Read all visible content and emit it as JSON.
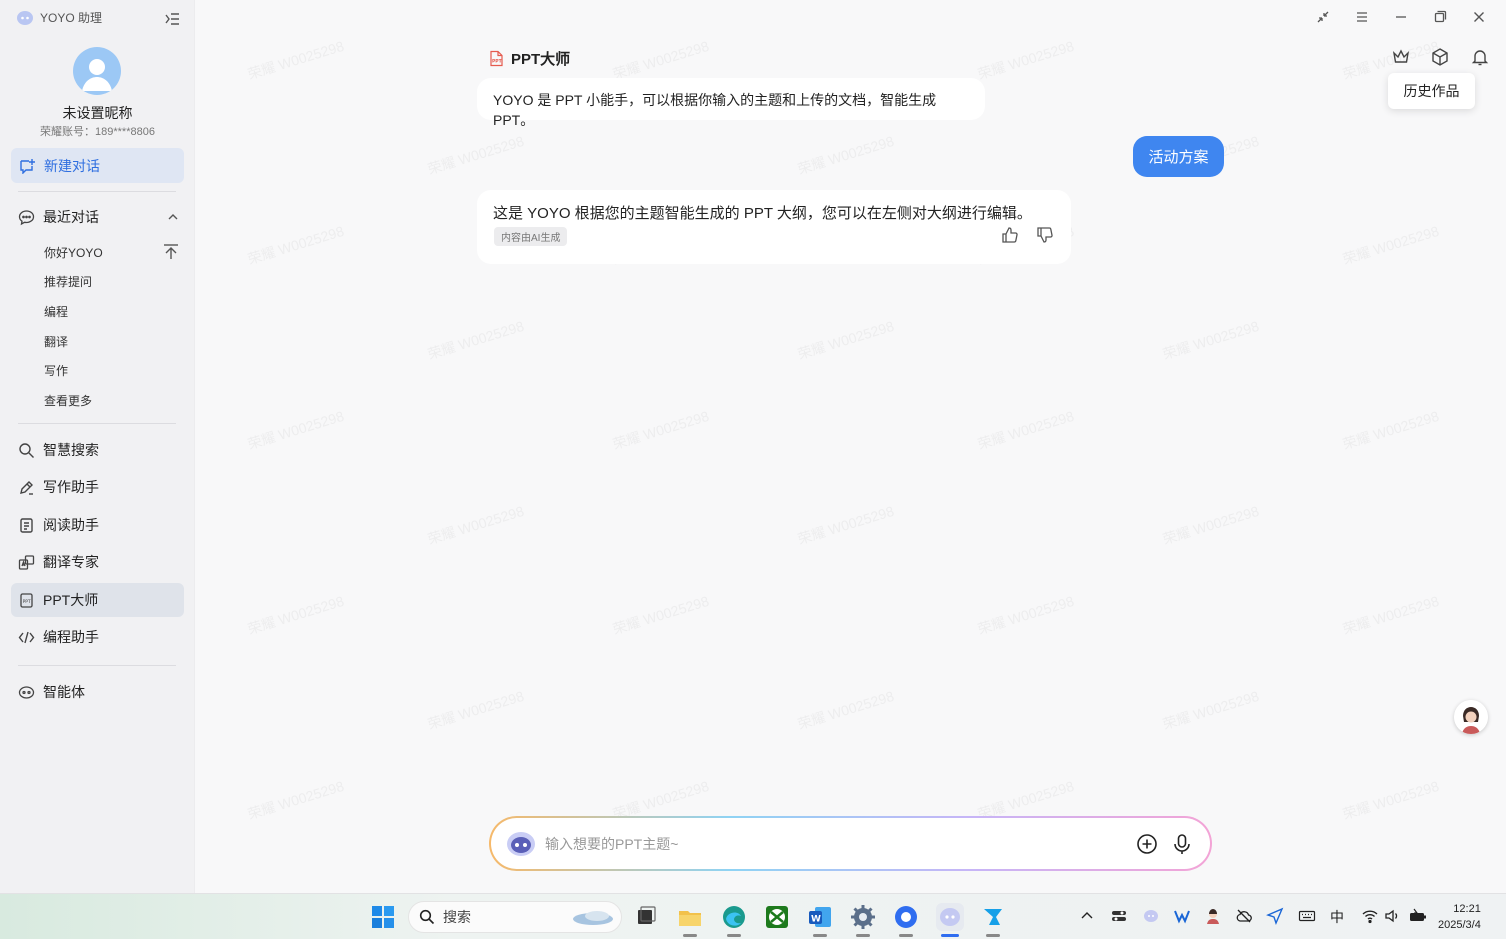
{
  "app": {
    "title": "YOYO 助理"
  },
  "profile": {
    "nickname": "未设置昵称",
    "account": "荣耀账号：189****8806"
  },
  "sidebar": {
    "new_chat": "新建对话",
    "recent_header": "最近对话",
    "recent_items": [
      "你好YOYO",
      "推荐提问",
      "编程",
      "翻译",
      "写作",
      "查看更多"
    ],
    "nav_items": [
      {
        "label": "智慧搜索",
        "icon": "search-icon"
      },
      {
        "label": "写作助手",
        "icon": "pen-icon"
      },
      {
        "label": "阅读助手",
        "icon": "document-icon"
      },
      {
        "label": "翻译专家",
        "icon": "translate-icon"
      },
      {
        "label": "PPT大师",
        "icon": "ppt-icon"
      },
      {
        "label": "编程助手",
        "icon": "code-icon"
      }
    ],
    "agent": "智能体"
  },
  "main": {
    "bot_title": "PPT大师",
    "intro_message": "YOYO 是 PPT 小能手，可以根据你输入的主题和上传的文档，智能生成 PPT。",
    "user_message": "活动方案",
    "reply_message": "这是 YOYO 根据您的主题智能生成的 PPT 大纲，您可以在左侧对大纲进行编辑。",
    "ai_tag": "内容由AI生成",
    "tooltip": "历史作品",
    "input_placeholder": "输入想要的PPT主题~",
    "watermark": "荣耀 W0025298"
  },
  "taskbar": {
    "search_label": "搜索",
    "ime": "中",
    "time": "12:21",
    "date": "2025/3/4"
  },
  "colors": {
    "accent": "#3f86f0",
    "active_bg": "#dfe6f3"
  }
}
